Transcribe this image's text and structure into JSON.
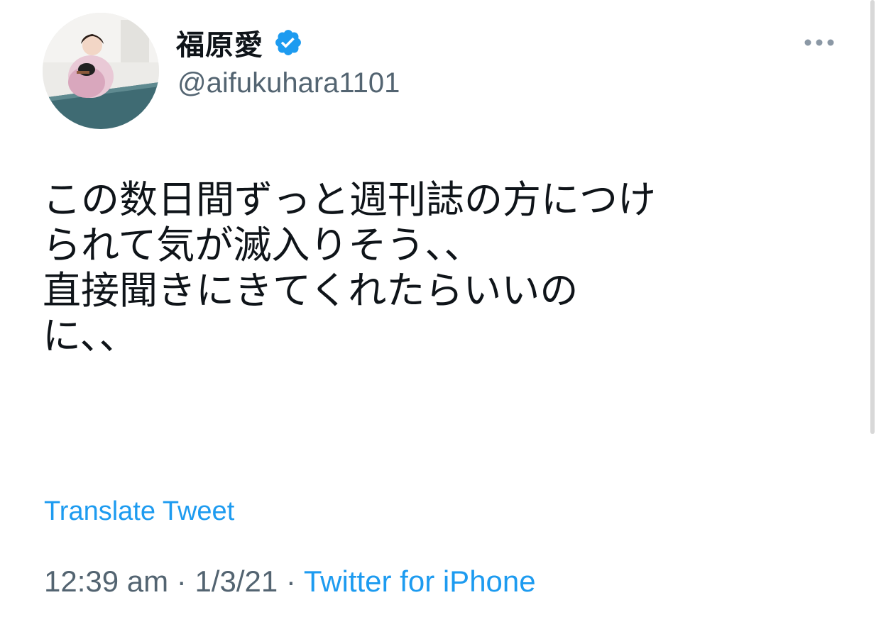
{
  "user": {
    "display_name": "福原愛",
    "handle": "@aifukuhara1101",
    "verified": true,
    "avatar_icon": "profile-photo-table-tennis"
  },
  "tweet": {
    "lines": [
      "この数日間ずっと週刊誌の方につけ",
      "られて気が滅入りそう、、",
      "直接聞きにきてくれたらいいの",
      "に、、"
    ]
  },
  "translate_label": "Translate Tweet",
  "meta": {
    "time": "12:39 am",
    "separator": " · ",
    "date": "1/3/21",
    "source": "Twitter for iPhone"
  },
  "colors": {
    "accent": "#1d9bf0",
    "secondary_text": "#536471",
    "primary_text": "#0f1419"
  }
}
